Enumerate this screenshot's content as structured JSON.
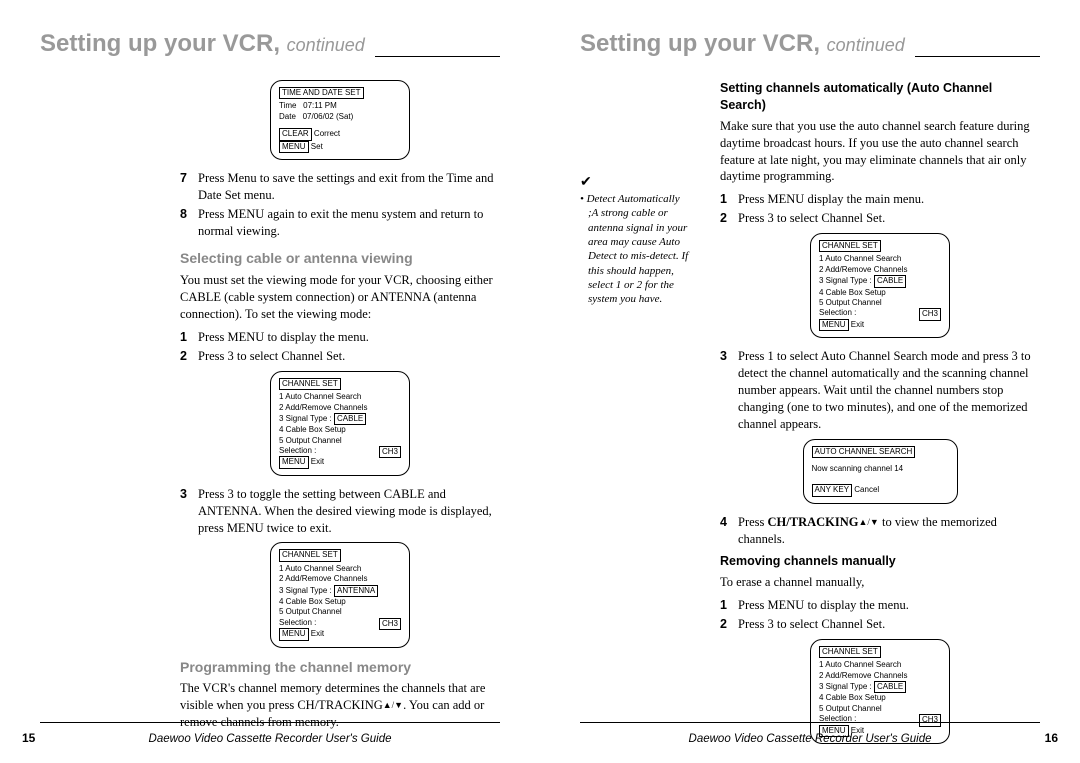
{
  "title_main": "Setting up your VCR,",
  "title_cont": "continued",
  "footer_text": "Daewoo Video Cassette Recorder User's Guide",
  "page_left_num": "15",
  "page_right_num": "16",
  "left": {
    "screen_time": {
      "title": "TIME AND DATE SET",
      "l1a": "Time",
      "l1b": "07:11 PM",
      "l2a": "Date",
      "l2b": "07/06/02 (Sat)",
      "l3a": "CLEAR",
      "l3b": "Correct",
      "l4a": "MENU",
      "l4b": "Set"
    },
    "step7_num": "7",
    "step7": "Press Menu to save the settings and exit from the Time and Date Set menu.",
    "step8_num": "8",
    "step8": "Press MENU again to exit the menu system and return to normal viewing.",
    "sec1_head": "Selecting cable or antenna viewing",
    "sec1_body": "You must set the viewing mode for your VCR, choosing either CABLE (cable system connection) or ANTENNA (antenna connection). To set the viewing mode:",
    "s1_num": "1",
    "s1": "Press MENU to display the menu.",
    "s2_num": "2",
    "s2": "Press 3 to select  Channel Set.",
    "screen_chset1": {
      "title": "CHANNEL SET",
      "l1": "1 Auto Channel Search",
      "l2": "2 Add/Remove Channels",
      "l3a": "3 Signal Type  :",
      "l3b": "CABLE",
      "l4": "4 Cable Box Setup",
      "l5": "5 Output Channel",
      "l6a": "   Selection   :",
      "l6b": "CH3",
      "l7a": "MENU",
      "l7b": "Exit"
    },
    "s3_num": "3",
    "s3": "Press 3 to toggle the setting between CABLE and ANTENNA. When the desired viewing mode is displayed, press MENU twice to exit.",
    "screen_chset2_l3b": "ANTENNA",
    "sec2_head": "Programming the channel memory",
    "sec2_body_a": "The VCR's channel memory determines the channels that are  visible when you press CH/TRACKING",
    "sec2_body_b": ". You can add or remove channels from memory."
  },
  "right": {
    "side_check": "✔",
    "side_head": "Detect Automatically",
    "side_body": ";A strong cable or antenna signal in your area may cause Auto Detect to mis-detect. If this should happen, select 1 or 2 for the system you have.",
    "sec1_head": "Setting channels automatically (Auto Channel Search)",
    "sec1_body": "Make sure that you use the auto channel search feature during daytime broadcast hours. If you use the auto channel search feature at late night, you may eliminate channels that air only daytime programming.",
    "s1_num": "1",
    "s1": "Press MENU display the main menu.",
    "s2_num": "2",
    "s2": "Press 3 to select Channel Set.",
    "s3_num": "3",
    "s3": "Press 1 to select Auto Channel Search mode and press 3 to detect the channel automatically and the scanning channel number appears. Wait until the channel numbers stop changing (one to two minutes), and one of the memorized channel appears.",
    "screen_auto": {
      "title": "AUTO CHANNEL SEARCH",
      "l1": "Now scanning channel 14",
      "l2a": "ANY KEY",
      "l2b": "Cancel"
    },
    "s4_num": "4",
    "s4_a": "Press ",
    "s4_bold": "CH/TRACKING",
    "s4_b": " to view the memorized channels.",
    "sec2_head": "Removing channels manually",
    "sec2_body": "To erase a channel manually,",
    "r1_num": "1",
    "r1": "Press MENU to display the menu.",
    "r2_num": "2",
    "r2": "Press 3 to select Channel Set."
  }
}
